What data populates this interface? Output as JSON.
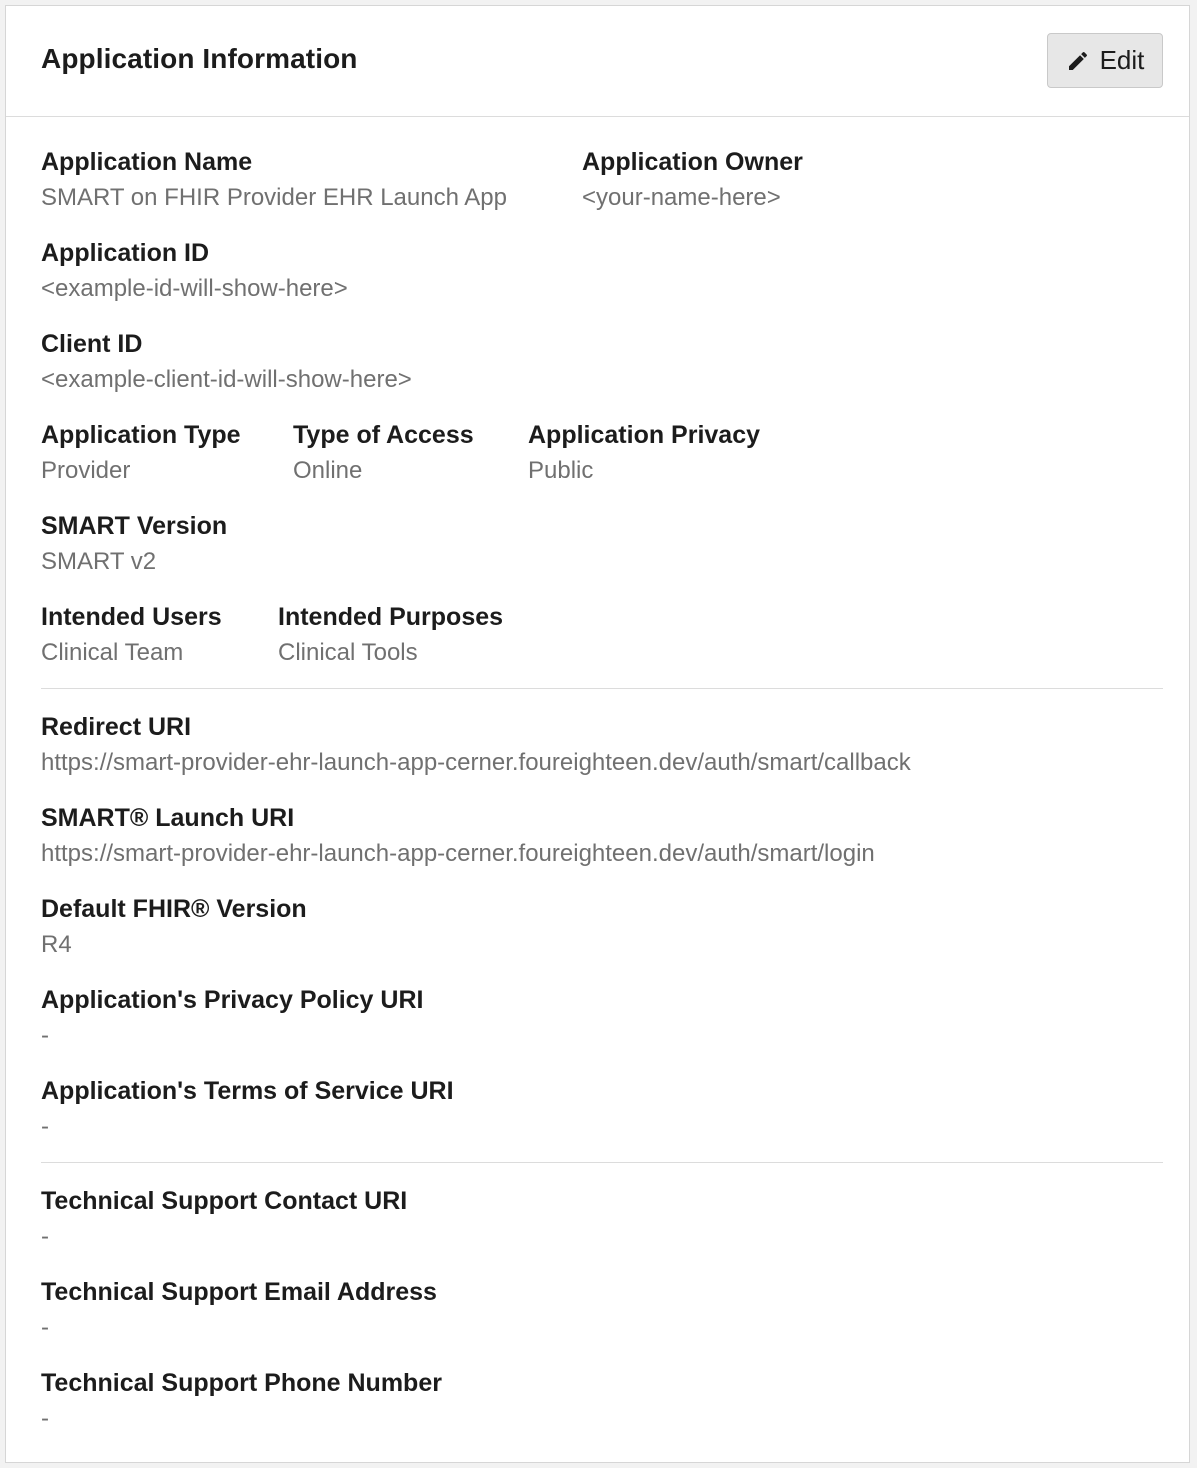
{
  "header": {
    "title": "Application Information",
    "edit_label": "Edit",
    "edit_icon": "pencil-icon"
  },
  "fields": {
    "app_name": {
      "label": "Application Name",
      "value": "SMART on FHIR Provider EHR Launch App"
    },
    "app_owner": {
      "label": "Application Owner",
      "value": "<your-name-here>"
    },
    "app_id": {
      "label": "Application ID",
      "value": "<example-id-will-show-here>"
    },
    "client_id": {
      "label": "Client ID",
      "value": "<example-client-id-will-show-here>"
    },
    "app_type": {
      "label": "Application Type",
      "value": "Provider"
    },
    "access_type": {
      "label": "Type of Access",
      "value": "Online"
    },
    "app_privacy": {
      "label": "Application Privacy",
      "value": "Public"
    },
    "smart_version": {
      "label": "SMART Version",
      "value": "SMART v2"
    },
    "intended_users": {
      "label": "Intended Users",
      "value": "Clinical Team"
    },
    "intended_purposes": {
      "label": "Intended Purposes",
      "value": "Clinical Tools"
    },
    "redirect_uri": {
      "label": "Redirect URI",
      "value": "https://smart-provider-ehr-launch-app-cerner.foureighteen.dev/auth/smart/callback"
    },
    "launch_uri": {
      "label": "SMART® Launch URI",
      "value": "https://smart-provider-ehr-launch-app-cerner.foureighteen.dev/auth/smart/login"
    },
    "fhir_version": {
      "label": "Default FHIR® Version",
      "value": "R4"
    },
    "privacy_policy_uri": {
      "label": "Application's Privacy Policy URI",
      "value": "-"
    },
    "tos_uri": {
      "label": "Application's Terms of Service URI",
      "value": "-"
    },
    "support_contact_uri": {
      "label": "Technical Support Contact URI",
      "value": "-"
    },
    "support_email": {
      "label": "Technical Support Email Address",
      "value": "-"
    },
    "support_phone": {
      "label": "Technical Support Phone Number",
      "value": "-"
    }
  }
}
